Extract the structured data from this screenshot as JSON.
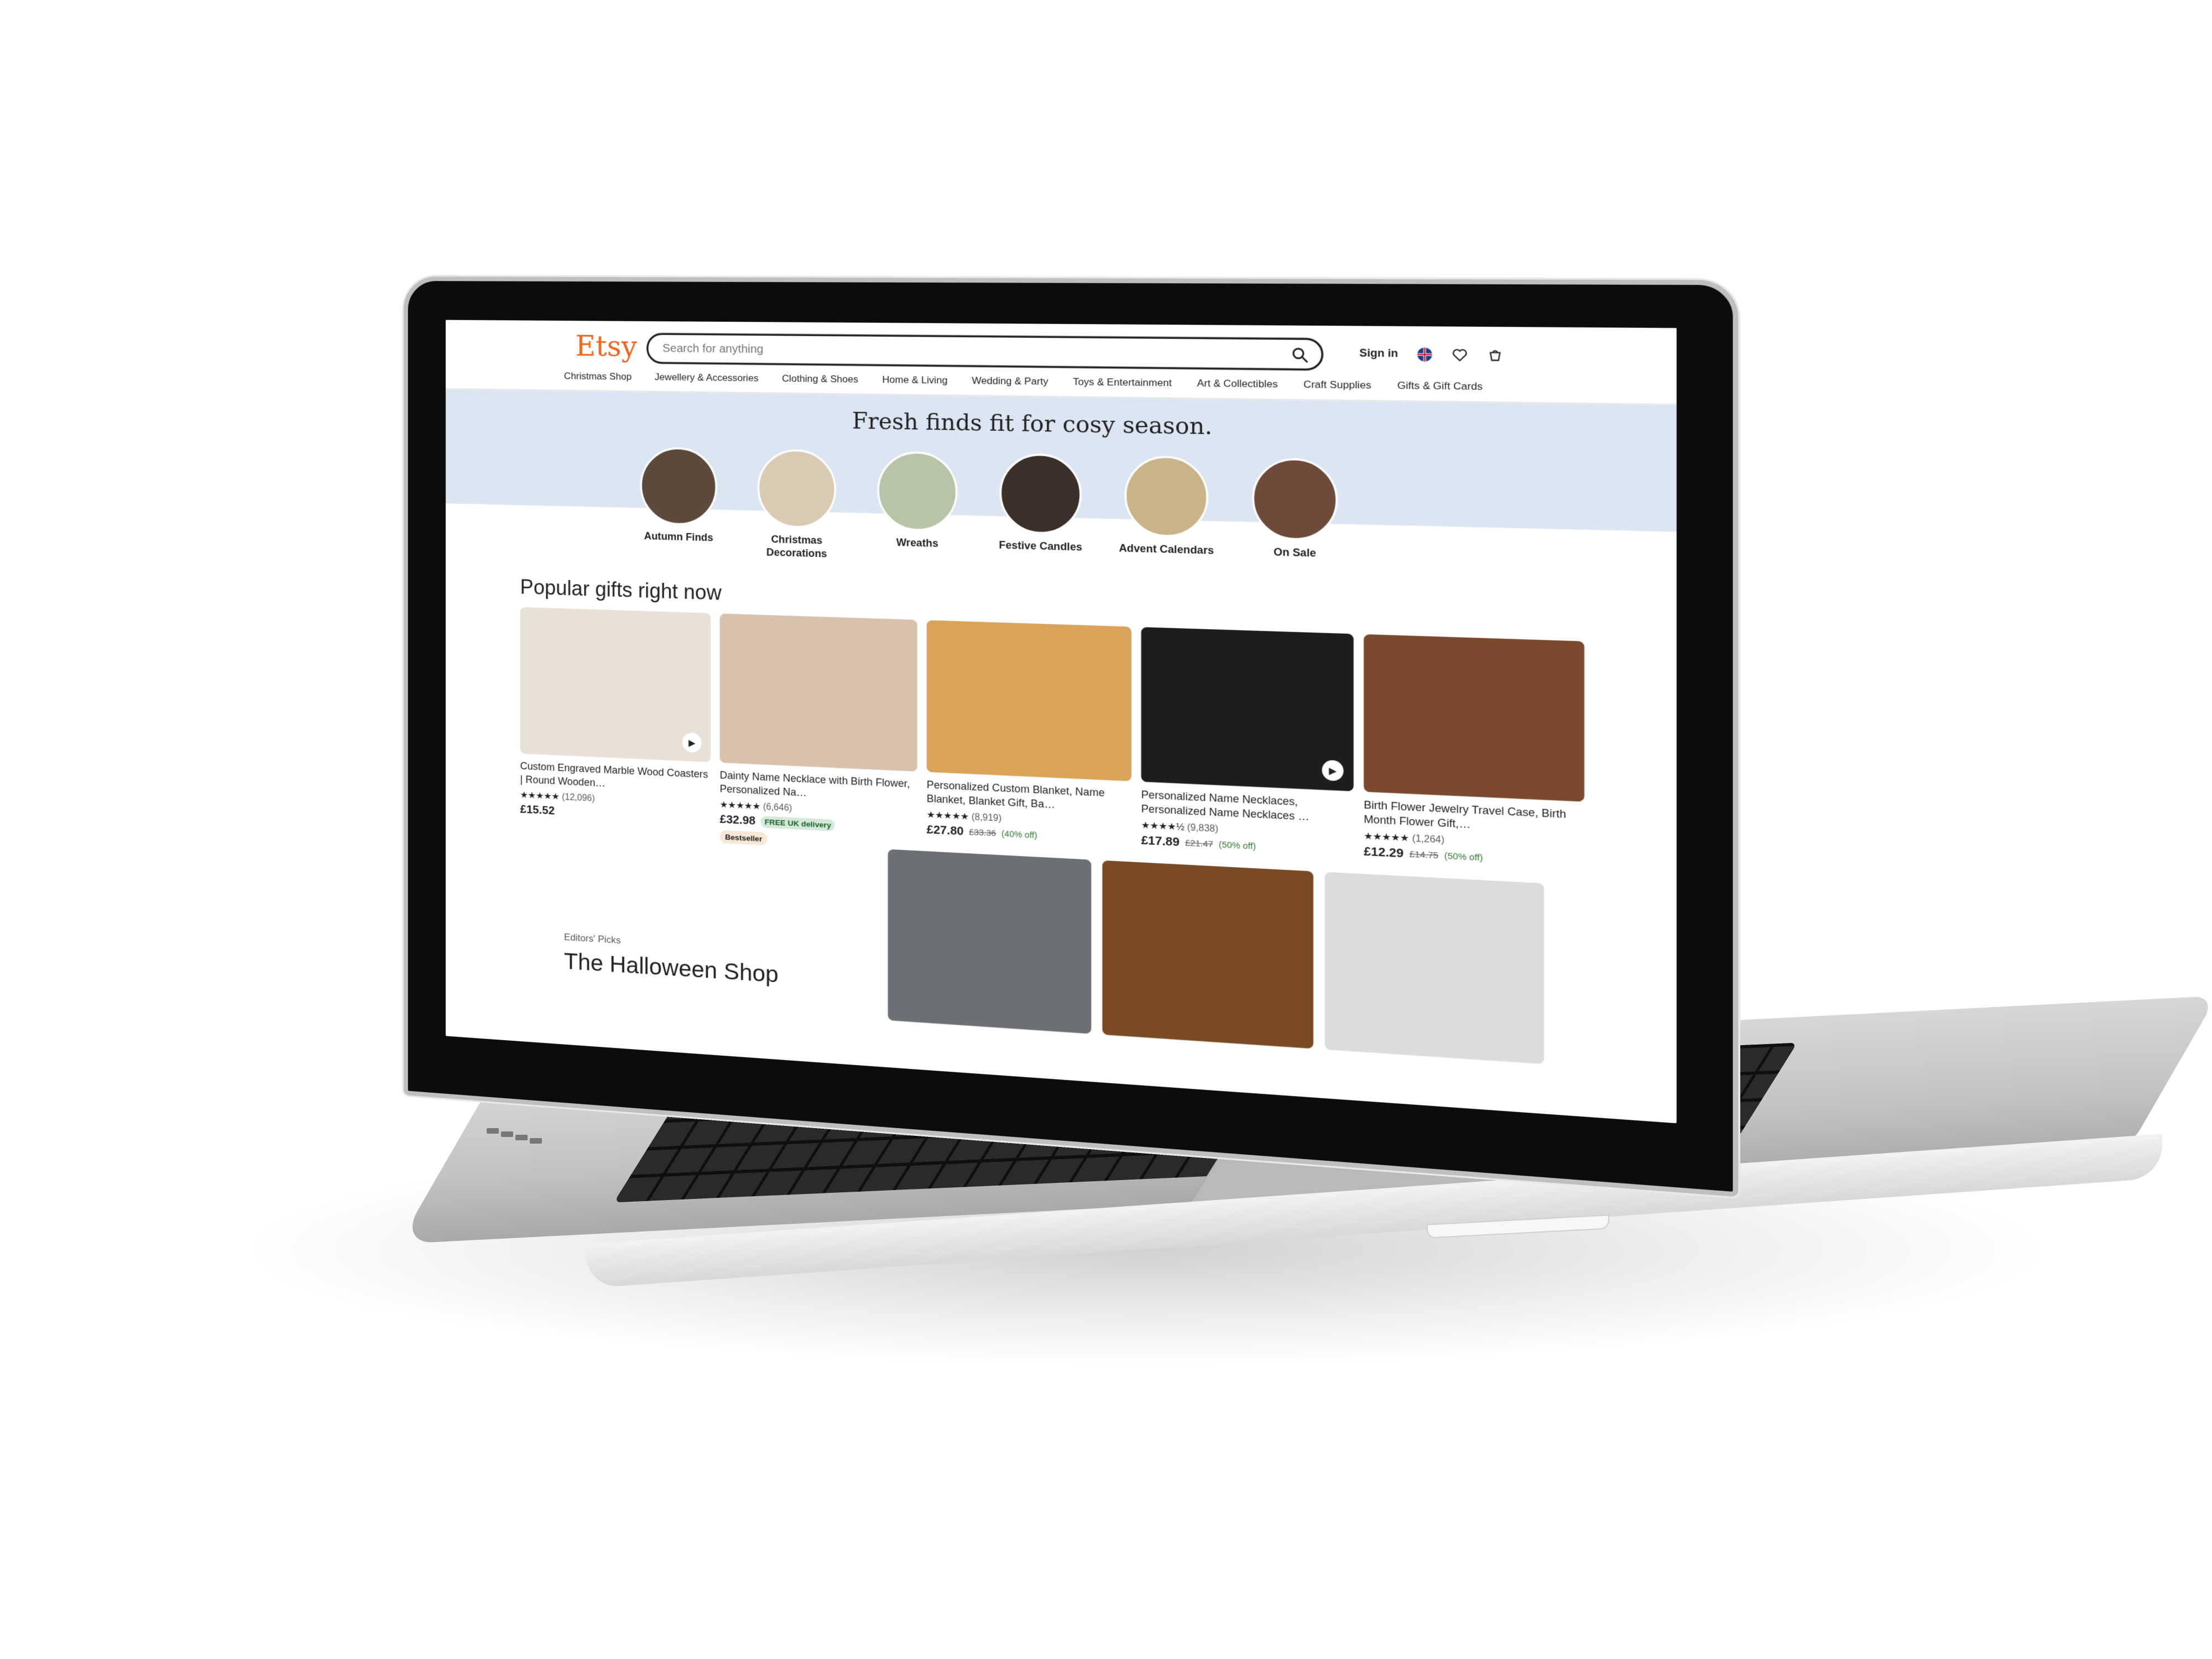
{
  "app": {
    "logo": "Etsy",
    "search_placeholder": "Search for anything",
    "sign_in": "Sign in"
  },
  "nav": [
    "Christmas Shop",
    "Jewellery & Accessories",
    "Clothing & Shoes",
    "Home & Living",
    "Wedding & Party",
    "Toys & Entertainment",
    "Art & Collectibles",
    "Craft Supplies",
    "Gifts & Gift Cards"
  ],
  "banner": {
    "title": "Fresh finds fit for cosy season.",
    "categories": [
      {
        "label": "Autumn Finds",
        "color": "#5b4a3c"
      },
      {
        "label": "Christmas Decorations",
        "color": "#d9cbb3"
      },
      {
        "label": "Wreaths",
        "color": "#b8c4a6"
      },
      {
        "label": "Festive Candles",
        "color": "#3b2f2a"
      },
      {
        "label": "Advent Calendars",
        "color": "#c9b487"
      },
      {
        "label": "On Sale",
        "color": "#6d4a3a"
      }
    ]
  },
  "popular": {
    "title": "Popular gifts right now",
    "products": [
      {
        "title": "Custom Engraved Marble Wood Coasters | Round Wooden…",
        "rating": "★★★★★",
        "count": "(12,096)",
        "price": "£15.52",
        "orig": "",
        "discount": "",
        "free": "",
        "bestseller": "",
        "color": "#e7e1d8",
        "video": "▶"
      },
      {
        "title": "Dainty Name Necklace with Birth Flower, Personalized Na…",
        "rating": "★★★★★",
        "count": "(6,646)",
        "price": "£32.98",
        "orig": "",
        "discount": "",
        "free": "FREE UK delivery",
        "bestseller": "Bestseller",
        "color": "#d8c2ae",
        "video": ""
      },
      {
        "title": "Personalized Custom Blanket, Name Blanket, Blanket Gift, Ba…",
        "rating": "★★★★★",
        "count": "(8,919)",
        "price": "£27.80",
        "orig": "£33.36",
        "discount": "(40% off)",
        "free": "",
        "bestseller": "",
        "color": "#d9a35a",
        "video": ""
      },
      {
        "title": "Personalized Name Necklaces, Personalized Name Necklaces …",
        "rating": "★★★★½",
        "count": "(9,838)",
        "price": "£17.89",
        "orig": "£21.47",
        "discount": "(50% off)",
        "free": "",
        "bestseller": "",
        "color": "#1d1d1d",
        "video": "▶"
      },
      {
        "title": "Birth Flower Jewelry Travel Case, Birth Month Flower Gift,…",
        "rating": "★★★★★",
        "count": "(1,264)",
        "price": "£12.29",
        "orig": "£14.75",
        "discount": "(50% off)",
        "free": "",
        "bestseller": "",
        "color": "#7b4a2e",
        "video": ""
      }
    ]
  },
  "halloween": {
    "kicker": "Editors' Picks",
    "title": "The Halloween Shop",
    "images": [
      "#6c6f74",
      "#7a4a24",
      "#dcdcdc"
    ]
  },
  "colors": {
    "brand": "#f1641e",
    "banner_bg": "#dbe6f2"
  }
}
